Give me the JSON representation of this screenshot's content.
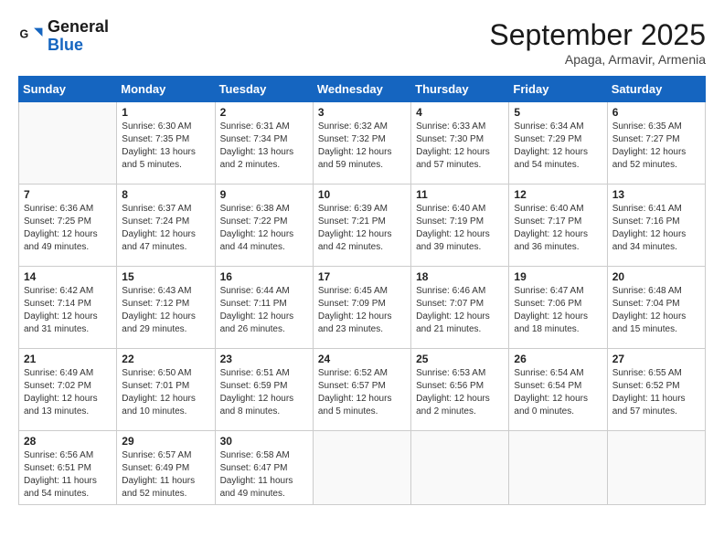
{
  "header": {
    "logo_line1": "General",
    "logo_line2": "Blue",
    "month": "September 2025",
    "location": "Apaga, Armavir, Armenia"
  },
  "days_of_week": [
    "Sunday",
    "Monday",
    "Tuesday",
    "Wednesday",
    "Thursday",
    "Friday",
    "Saturday"
  ],
  "weeks": [
    [
      {
        "day": "",
        "info": ""
      },
      {
        "day": "1",
        "info": "Sunrise: 6:30 AM\nSunset: 7:35 PM\nDaylight: 13 hours\nand 5 minutes."
      },
      {
        "day": "2",
        "info": "Sunrise: 6:31 AM\nSunset: 7:34 PM\nDaylight: 13 hours\nand 2 minutes."
      },
      {
        "day": "3",
        "info": "Sunrise: 6:32 AM\nSunset: 7:32 PM\nDaylight: 12 hours\nand 59 minutes."
      },
      {
        "day": "4",
        "info": "Sunrise: 6:33 AM\nSunset: 7:30 PM\nDaylight: 12 hours\nand 57 minutes."
      },
      {
        "day": "5",
        "info": "Sunrise: 6:34 AM\nSunset: 7:29 PM\nDaylight: 12 hours\nand 54 minutes."
      },
      {
        "day": "6",
        "info": "Sunrise: 6:35 AM\nSunset: 7:27 PM\nDaylight: 12 hours\nand 52 minutes."
      }
    ],
    [
      {
        "day": "7",
        "info": "Sunrise: 6:36 AM\nSunset: 7:25 PM\nDaylight: 12 hours\nand 49 minutes."
      },
      {
        "day": "8",
        "info": "Sunrise: 6:37 AM\nSunset: 7:24 PM\nDaylight: 12 hours\nand 47 minutes."
      },
      {
        "day": "9",
        "info": "Sunrise: 6:38 AM\nSunset: 7:22 PM\nDaylight: 12 hours\nand 44 minutes."
      },
      {
        "day": "10",
        "info": "Sunrise: 6:39 AM\nSunset: 7:21 PM\nDaylight: 12 hours\nand 42 minutes."
      },
      {
        "day": "11",
        "info": "Sunrise: 6:40 AM\nSunset: 7:19 PM\nDaylight: 12 hours\nand 39 minutes."
      },
      {
        "day": "12",
        "info": "Sunrise: 6:40 AM\nSunset: 7:17 PM\nDaylight: 12 hours\nand 36 minutes."
      },
      {
        "day": "13",
        "info": "Sunrise: 6:41 AM\nSunset: 7:16 PM\nDaylight: 12 hours\nand 34 minutes."
      }
    ],
    [
      {
        "day": "14",
        "info": "Sunrise: 6:42 AM\nSunset: 7:14 PM\nDaylight: 12 hours\nand 31 minutes."
      },
      {
        "day": "15",
        "info": "Sunrise: 6:43 AM\nSunset: 7:12 PM\nDaylight: 12 hours\nand 29 minutes."
      },
      {
        "day": "16",
        "info": "Sunrise: 6:44 AM\nSunset: 7:11 PM\nDaylight: 12 hours\nand 26 minutes."
      },
      {
        "day": "17",
        "info": "Sunrise: 6:45 AM\nSunset: 7:09 PM\nDaylight: 12 hours\nand 23 minutes."
      },
      {
        "day": "18",
        "info": "Sunrise: 6:46 AM\nSunset: 7:07 PM\nDaylight: 12 hours\nand 21 minutes."
      },
      {
        "day": "19",
        "info": "Sunrise: 6:47 AM\nSunset: 7:06 PM\nDaylight: 12 hours\nand 18 minutes."
      },
      {
        "day": "20",
        "info": "Sunrise: 6:48 AM\nSunset: 7:04 PM\nDaylight: 12 hours\nand 15 minutes."
      }
    ],
    [
      {
        "day": "21",
        "info": "Sunrise: 6:49 AM\nSunset: 7:02 PM\nDaylight: 12 hours\nand 13 minutes."
      },
      {
        "day": "22",
        "info": "Sunrise: 6:50 AM\nSunset: 7:01 PM\nDaylight: 12 hours\nand 10 minutes."
      },
      {
        "day": "23",
        "info": "Sunrise: 6:51 AM\nSunset: 6:59 PM\nDaylight: 12 hours\nand 8 minutes."
      },
      {
        "day": "24",
        "info": "Sunrise: 6:52 AM\nSunset: 6:57 PM\nDaylight: 12 hours\nand 5 minutes."
      },
      {
        "day": "25",
        "info": "Sunrise: 6:53 AM\nSunset: 6:56 PM\nDaylight: 12 hours\nand 2 minutes."
      },
      {
        "day": "26",
        "info": "Sunrise: 6:54 AM\nSunset: 6:54 PM\nDaylight: 12 hours\nand 0 minutes."
      },
      {
        "day": "27",
        "info": "Sunrise: 6:55 AM\nSunset: 6:52 PM\nDaylight: 11 hours\nand 57 minutes."
      }
    ],
    [
      {
        "day": "28",
        "info": "Sunrise: 6:56 AM\nSunset: 6:51 PM\nDaylight: 11 hours\nand 54 minutes."
      },
      {
        "day": "29",
        "info": "Sunrise: 6:57 AM\nSunset: 6:49 PM\nDaylight: 11 hours\nand 52 minutes."
      },
      {
        "day": "30",
        "info": "Sunrise: 6:58 AM\nSunset: 6:47 PM\nDaylight: 11 hours\nand 49 minutes."
      },
      {
        "day": "",
        "info": ""
      },
      {
        "day": "",
        "info": ""
      },
      {
        "day": "",
        "info": ""
      },
      {
        "day": "",
        "info": ""
      }
    ]
  ]
}
